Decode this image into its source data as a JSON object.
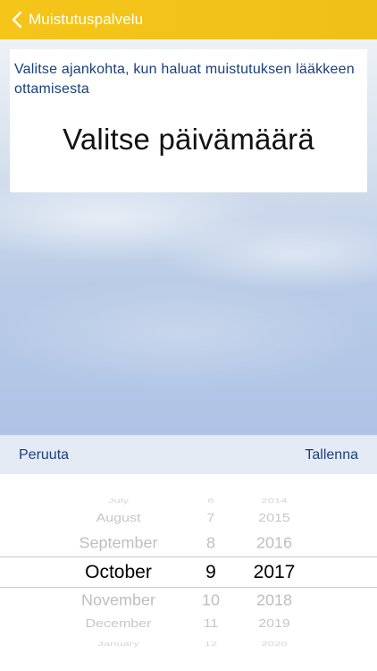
{
  "nav": {
    "back_label": "Muistutuspalvelu"
  },
  "card": {
    "instruction": "Valitse ajankohta, kun haluat muistutuksen lääkkeen ottamisesta",
    "title": "Valitse päivämäärä"
  },
  "toolbar": {
    "cancel_label": "Peruuta",
    "save_label": "Tallenna"
  },
  "picker": {
    "months": [
      "July",
      "August",
      "September",
      "October",
      "November",
      "December",
      "January"
    ],
    "days": [
      "6",
      "7",
      "8",
      "9",
      "10",
      "11",
      "12"
    ],
    "years": [
      "2014",
      "2015",
      "2016",
      "2017",
      "2018",
      "2019",
      "2020"
    ],
    "selected": {
      "month": "October",
      "day": "9",
      "year": "2017"
    }
  },
  "colors": {
    "navbar": "#f5c51a",
    "accent_text": "#1b3f7d",
    "toolbar_bg": "#e5ebf5"
  }
}
